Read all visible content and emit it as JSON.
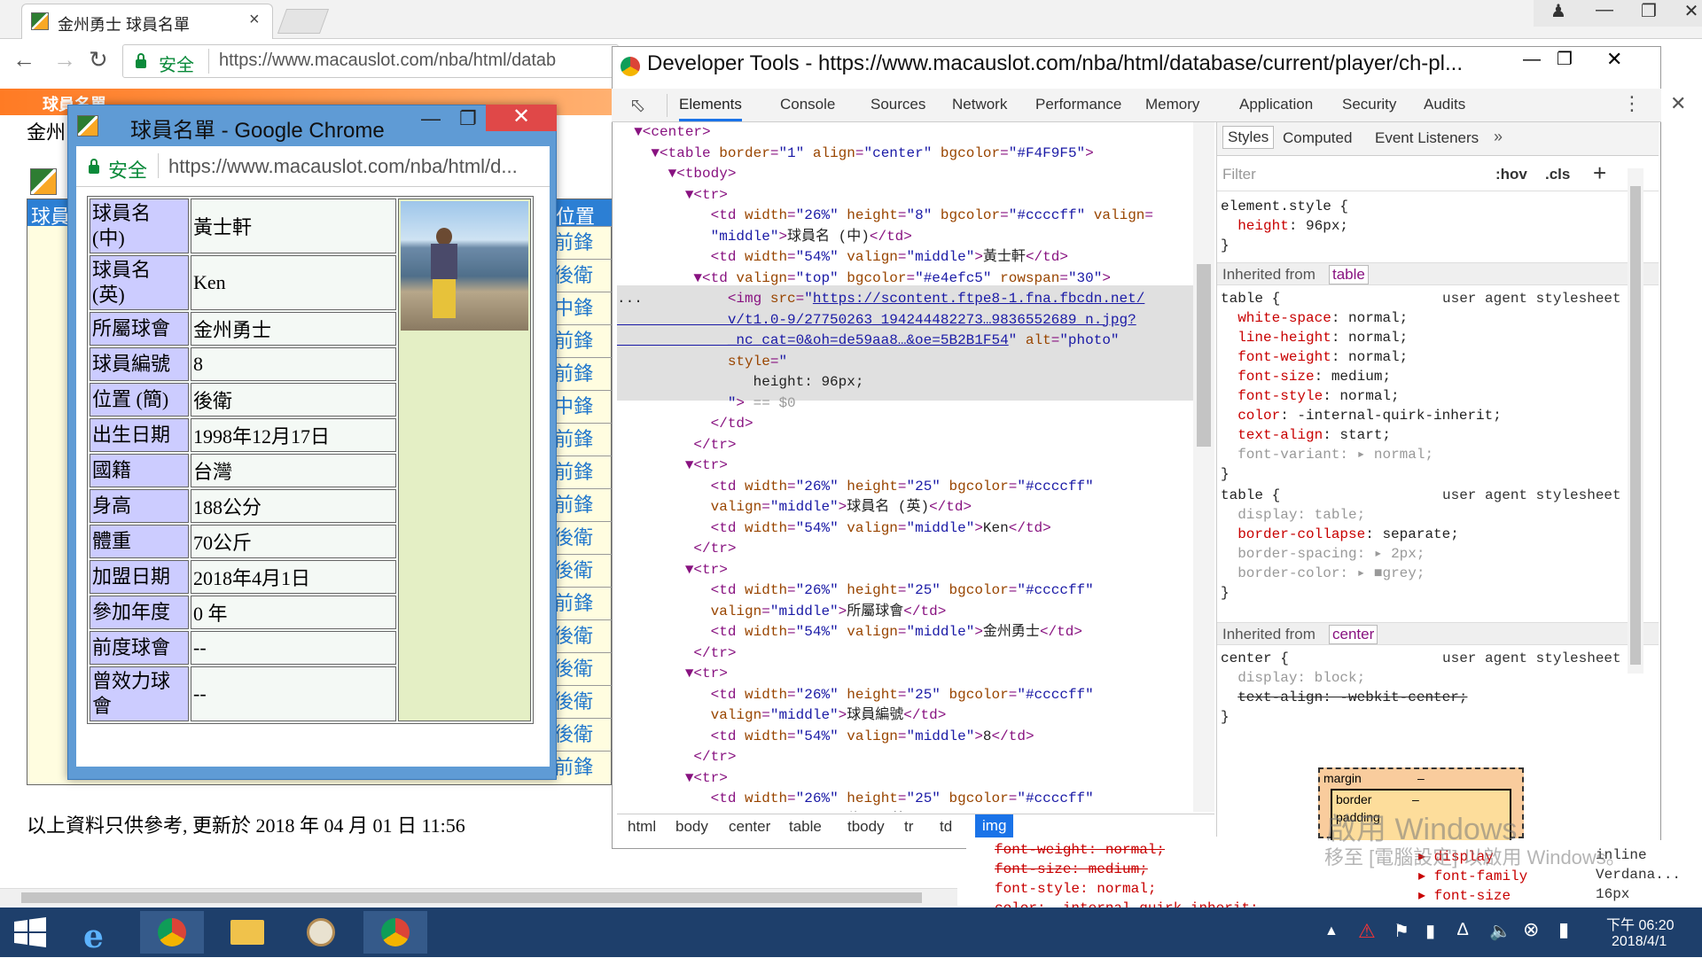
{
  "main_browser": {
    "tab_title": "金州勇士 球員名單",
    "security_label": "安全",
    "url": "https://www.macauslot.com/nba/html/datab",
    "page_banner": "球員名單",
    "page_heading": "金州",
    "page_header_fragment": "球員",
    "position_column_header": "位置",
    "position_values": [
      "前鋒",
      "後衛",
      "中鋒",
      "前鋒",
      "前鋒",
      "中鋒",
      "前鋒",
      "前鋒",
      "前鋒",
      "後衛",
      "後衛",
      "前鋒",
      "後衛",
      "後衛",
      "後衛",
      "後衛",
      "前鋒"
    ],
    "footer_note": "以上資料只供參考, 更新於 2018 年 04 月 01 日  11:56"
  },
  "popup": {
    "title": "球員名單 - Google Chrome",
    "security_label": "安全",
    "url": "https://www.macauslot.com/nba/html/d...",
    "rows": [
      {
        "label": "球員名\n(中)",
        "value": "黃士軒"
      },
      {
        "label": "球員名\n(英)",
        "value": "Ken"
      },
      {
        "label": "所屬球會",
        "value": "金州勇士"
      },
      {
        "label": "球員編號",
        "value": "8"
      },
      {
        "label": "位置 (簡)",
        "value": "後衛"
      },
      {
        "label": "出生日期",
        "value": "1998年12月17日"
      },
      {
        "label": "國籍",
        "value": "台灣"
      },
      {
        "label": "身高",
        "value": "188公分"
      },
      {
        "label": "體重",
        "value": "70公斤"
      },
      {
        "label": "加盟日期",
        "value": "2018年4月1日"
      },
      {
        "label": "參加年度",
        "value": "0 年"
      },
      {
        "label": "前度球會",
        "value": "--"
      },
      {
        "label": "曾效力球\n會",
        "value": "--"
      }
    ]
  },
  "devtools": {
    "title": "Developer Tools - https://www.macauslot.com/nba/html/database/current/player/ch-pl...",
    "tabs": [
      "Elements",
      "Console",
      "Sources",
      "Network",
      "Performance",
      "Memory",
      "Application",
      "Security",
      "Audits"
    ],
    "active_tab": "Elements",
    "breadcrumbs": [
      "html",
      "body",
      "center",
      "table",
      "tbody",
      "tr",
      "td",
      "img"
    ],
    "active_breadcrumb": "img",
    "styles_tabs": [
      "Styles",
      "Computed",
      "Event Listeners"
    ],
    "filter_placeholder": "Filter",
    "hov": ":hov",
    "cls": ".cls",
    "inherited_from_label": "Inherited from",
    "inherited_table": "table",
    "inherited_center": "center",
    "ua_label": "user agent stylesheet",
    "box_margin": "margin",
    "box_border": "border",
    "box_padding": "padding",
    "box_dash": "–",
    "computed_bits": [
      "font-weight: normal;",
      "font-size: medium;",
      "font-style: normal;",
      "color: -internal-quirk-inherit;"
    ],
    "computed_right": [
      "display",
      "font-family",
      "font-size"
    ],
    "computed_right_vals": [
      "inline",
      "Verdana...",
      "16px"
    ]
  },
  "watermark": {
    "line1": "啟用 Windows",
    "line2": "移至 [電腦設定] 以啟用 Windows。"
  },
  "taskbar": {
    "time": "下午 06:20",
    "date": "2018/4/1"
  }
}
